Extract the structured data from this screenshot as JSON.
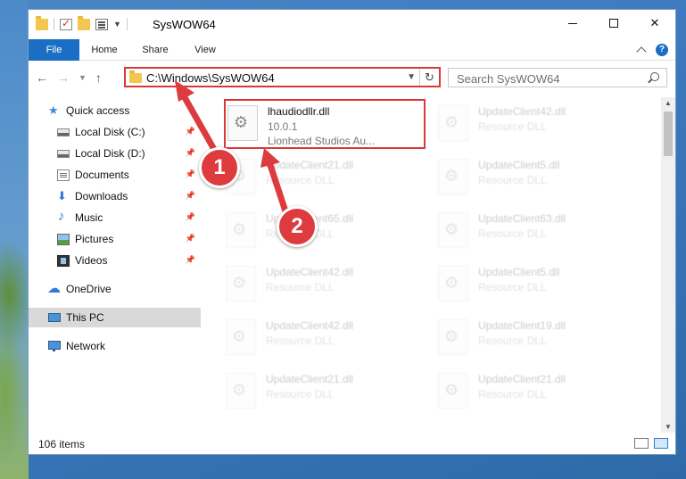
{
  "window": {
    "title": "SysWOW64"
  },
  "ribbon": {
    "tabs": [
      "File",
      "Home",
      "Share",
      "View"
    ],
    "help": "?"
  },
  "address": {
    "path": "C:\\Windows\\SysWOW64",
    "refresh": "↻"
  },
  "search": {
    "placeholder": "Search SysWOW64"
  },
  "sidebar": {
    "items": [
      {
        "label": "Quick access",
        "icon": "quick-access-star-icon",
        "pinned": false
      },
      {
        "label": "Local Disk (C:)",
        "icon": "drive-icon",
        "pinned": true
      },
      {
        "label": "Local Disk (D:)",
        "icon": "drive-icon",
        "pinned": true
      },
      {
        "label": "Documents",
        "icon": "documents-icon",
        "pinned": true
      },
      {
        "label": "Downloads",
        "icon": "download-arrow-icon",
        "pinned": true
      },
      {
        "label": "Music",
        "icon": "music-note-icon",
        "pinned": true
      },
      {
        "label": "Pictures",
        "icon": "pictures-icon",
        "pinned": true
      },
      {
        "label": "Videos",
        "icon": "videos-icon",
        "pinned": true
      },
      {
        "label": "OneDrive",
        "icon": "onedrive-cloud-icon",
        "pinned": false
      },
      {
        "label": "This PC",
        "icon": "monitor-icon",
        "pinned": false,
        "selected": true
      },
      {
        "label": "Network",
        "icon": "network-icon",
        "pinned": false
      }
    ]
  },
  "files": [
    {
      "name": "lhaudiodllr.dll",
      "line2": "10.0.1",
      "line3": "Lionhead Studios Au...",
      "highlighted": true
    },
    {
      "name": "UpdateClient42.dll",
      "line2": "Resource DLL"
    },
    {
      "name": "UpdateClient21.dll",
      "line2": "Resource DLL"
    },
    {
      "name": "UpdateClient5.dll",
      "line2": "Resource DLL"
    },
    {
      "name": "UpdateClient65.dll",
      "line2": "Resource DLL"
    },
    {
      "name": "UpdateClient63.dll",
      "line2": "Resource DLL"
    },
    {
      "name": "UpdateClient42.dll",
      "line2": "Resource DLL"
    },
    {
      "name": "UpdateClient5.dll",
      "line2": "Resource DLL"
    },
    {
      "name": "UpdateClient42.dll",
      "line2": "Resource DLL"
    },
    {
      "name": "UpdateClient19.dll",
      "line2": "Resource DLL"
    },
    {
      "name": "UpdateClient21.dll",
      "line2": "Resource DLL"
    },
    {
      "name": "UpdateClient21.dll",
      "line2": "Resource DLL"
    }
  ],
  "status": {
    "item_count": "106 items"
  },
  "annotations": {
    "step1": "1",
    "step2": "2",
    "color": "#dd3b3d"
  }
}
